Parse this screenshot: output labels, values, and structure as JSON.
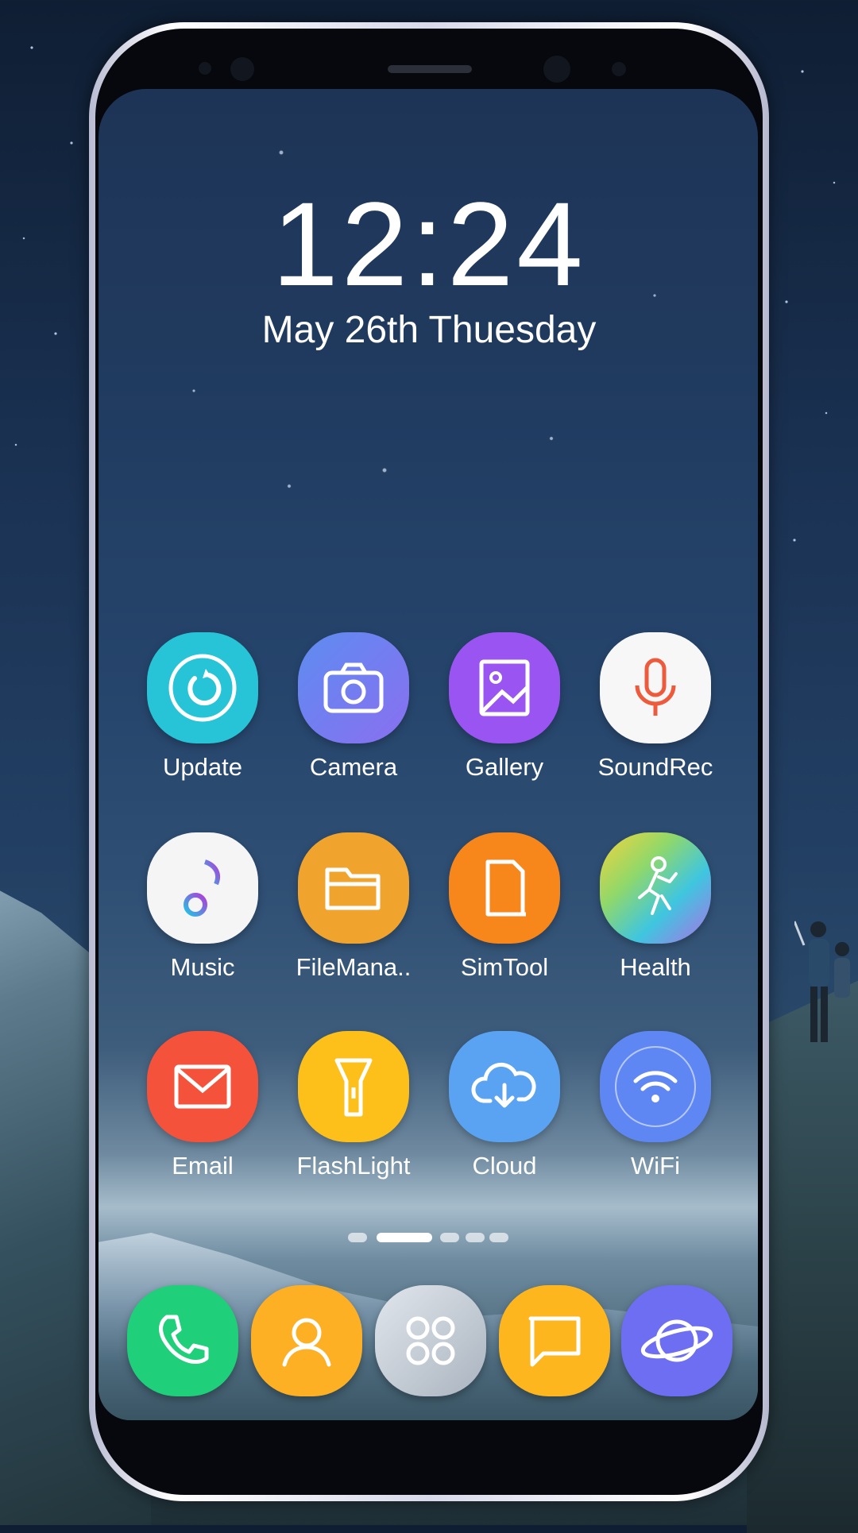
{
  "lockscreen": {
    "time": "12:24",
    "date": "May 26th Thuesday"
  },
  "apps": [
    {
      "label": "Update",
      "icon": "update-icon",
      "color": "#27c3d6"
    },
    {
      "label": "Camera",
      "icon": "camera-icon",
      "color": "#7b7df0"
    },
    {
      "label": "Gallery",
      "icon": "gallery-icon",
      "color": "#9a54f2"
    },
    {
      "label": "SoundRec",
      "icon": "microphone-icon",
      "color": "#f7f7f7"
    },
    {
      "label": "Music",
      "icon": "music-note-icon",
      "color": "#f5f5f5"
    },
    {
      "label": "FileMana..",
      "icon": "folder-icon",
      "color": "#f0a42e"
    },
    {
      "label": "SimTool",
      "icon": "sim-card-icon",
      "color": "#f7861b"
    },
    {
      "label": "Health",
      "icon": "health-runner-icon",
      "color": "#9fd76a"
    },
    {
      "label": "Email",
      "icon": "envelope-icon",
      "color": "#f4523a"
    },
    {
      "label": "FlashLight",
      "icon": "flashlight-icon",
      "color": "#fdc01a"
    },
    {
      "label": "Cloud",
      "icon": "cloud-sync-icon",
      "color": "#5aa3f2"
    },
    {
      "label": "WiFi",
      "icon": "wifi-icon",
      "color": "#5f87f3"
    }
  ],
  "pager": {
    "page_count": 5,
    "active_page": 2
  },
  "dock": [
    {
      "icon": "phone-icon",
      "color": "#1fcf7a"
    },
    {
      "icon": "contacts-icon",
      "color": "#fdb024"
    },
    {
      "icon": "app-drawer-icon",
      "color": "#c9d0d8"
    },
    {
      "icon": "messages-icon",
      "color": "#fdb61e"
    },
    {
      "icon": "internet-planet-icon",
      "color": "#6d6ef2"
    }
  ]
}
